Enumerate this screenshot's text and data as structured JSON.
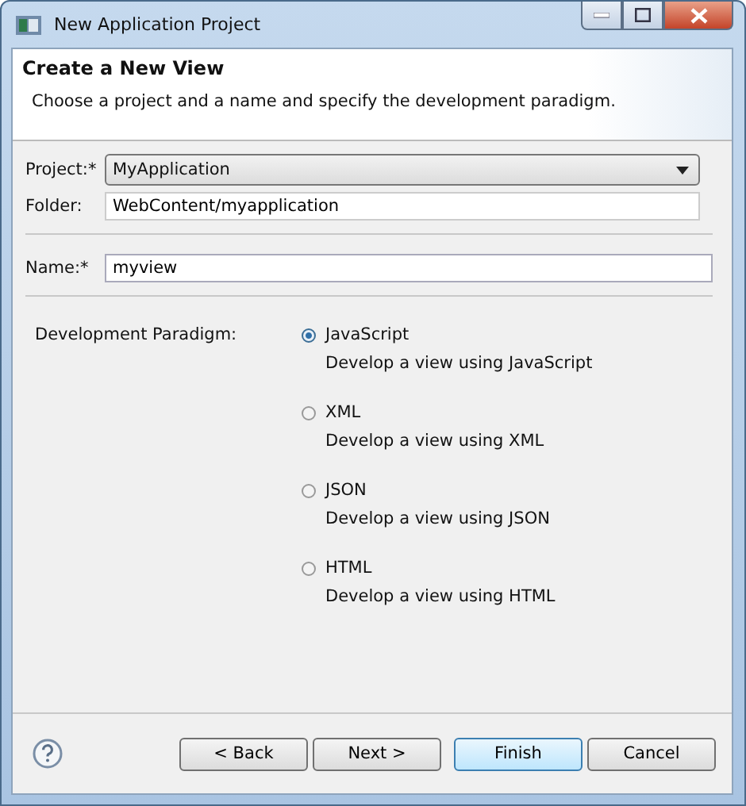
{
  "window": {
    "title": "New Application Project"
  },
  "header": {
    "title": "Create a New View",
    "description": "Choose a project and a name and specify the development paradigm."
  },
  "project": {
    "label": "Project:*",
    "value": "MyApplication"
  },
  "folder": {
    "label": "Folder:",
    "value": "WebContent/myapplication"
  },
  "name": {
    "label": "Name:*",
    "value": "myview"
  },
  "paradigm": {
    "label": "Development Paradigm:",
    "options": [
      {
        "label": "JavaScript",
        "description": "Develop a view using JavaScript",
        "selected": true
      },
      {
        "label": "XML",
        "description": "Develop a view using XML",
        "selected": false
      },
      {
        "label": "JSON",
        "description": "Develop a view using JSON",
        "selected": false
      },
      {
        "label": "HTML",
        "description": "Develop a view using HTML",
        "selected": false
      }
    ]
  },
  "buttons": [
    {
      "label": "< Back",
      "default": false
    },
    {
      "label": "Next >",
      "default": false
    },
    {
      "label": "Finish",
      "default": true
    },
    {
      "label": "Cancel",
      "default": false
    }
  ]
}
